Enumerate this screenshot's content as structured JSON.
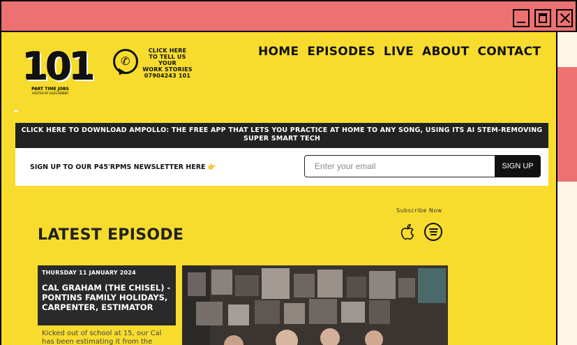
{
  "nav": {
    "items": [
      "HOME",
      "EPISODES",
      "LIVE",
      "ABOUT",
      "CONTACT"
    ]
  },
  "logo": {
    "number": "101",
    "subtitle": "PART TIME JOBS",
    "tagline": "HOSTED BY GILES BIBBER"
  },
  "whatsapp_cta": {
    "lines": [
      "CLICK HERE",
      "TO TELL US YOUR",
      "WORK STORIES",
      "07904243 101"
    ]
  },
  "promo_banner": {
    "text": "CLICK HERE TO DOWNLOAD AMPOLLO: THE FREE APP THAT LETS YOU PRACTICE AT HOME TO ANY SONG, USING ITS AI STEM-REMOVING SUPER SMART TECH"
  },
  "newsletter": {
    "label": "SIGN UP TO OUR P45'RPMS NEWSLETTER HERE",
    "hand_emoji": "👉",
    "email_placeholder": "Enter your email",
    "button_label": "SIGN UP"
  },
  "subscribe": {
    "label": "Subscribe Now",
    "icons": [
      "apple-podcasts-icon",
      "spotify-icon"
    ]
  },
  "latest": {
    "heading": "LATEST EPISODE",
    "date": "THURSDAY 11 JANUARY 2024",
    "title": "CAL GRAHAM (THE CHISEL) - PONTINS FAMILY HOLIDAYS, CARPENTER, ESTIMATOR",
    "description": "Kicked out of school at 15, our Cal has been estimating it from the"
  },
  "colors": {
    "page_bg": "#f7dc2e",
    "titlebar": "#ee7171",
    "banner": "#222222"
  }
}
